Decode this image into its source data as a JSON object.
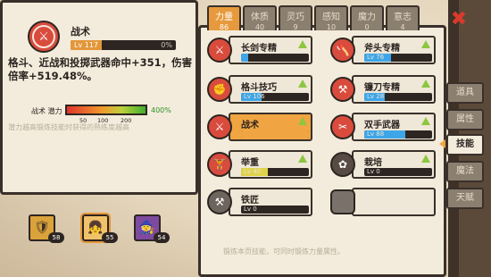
{
  "info": {
    "skill_name": "战术",
    "level": "Lv 117",
    "progress": "0%",
    "description": "格斗、近战和投掷武器命中+351，伤害倍率+519.48%。",
    "potential_label": "战术 潜力",
    "potential_value": "400%",
    "ticks": [
      "50",
      "100",
      "200"
    ],
    "note": "潜力越高锻炼技能时获得的熟练度越高"
  },
  "companions": [
    {
      "level": "58"
    },
    {
      "level": "55"
    },
    {
      "level": "54"
    }
  ],
  "tabs": [
    {
      "label": "力量",
      "value": "86"
    },
    {
      "label": "体质",
      "value": "40"
    },
    {
      "label": "灵巧",
      "value": "9"
    },
    {
      "label": "感知",
      "value": "10"
    },
    {
      "label": "魔力",
      "value": "0"
    },
    {
      "label": "意志",
      "value": "4"
    }
  ],
  "skills": [
    {
      "name": "长剑专精",
      "level": "",
      "icon": "sword-icon",
      "bar_fill": 0.1
    },
    {
      "name": "斧头专精",
      "level": "Lv 76",
      "icon": "axe-icon",
      "bar_fill": 0.4
    },
    {
      "name": "格斗技巧",
      "level": "Lv 106",
      "icon": "fist-icon",
      "bar_fill": 0.3
    },
    {
      "name": "镰刀专精",
      "level": "Lv 28",
      "icon": "scythe-icon",
      "bar_fill": 0.3
    },
    {
      "name": "战术",
      "level": "",
      "icon": "tactics-icon",
      "bar_fill": 1.0
    },
    {
      "name": "双手武器",
      "level": "Lv 88",
      "icon": "twohand-icon",
      "bar_fill": 0.6
    },
    {
      "name": "举重",
      "level": "Lv 40",
      "icon": "dumbbell-icon",
      "bar_fill": 0.4
    },
    {
      "name": "栽培",
      "level": "Lv 0",
      "icon": "plant-icon",
      "bar_fill": 0.0
    },
    {
      "name": "铁匠",
      "level": "Lv 0",
      "icon": "anvil-icon",
      "bar_fill": 0.0
    },
    {
      "name": "",
      "level": "",
      "icon": "locked-hex-icon",
      "bar_fill": 0.0
    }
  ],
  "footer_note": "锻炼本页技能，可同时锻炼力量属性。",
  "side_menu": [
    "道具",
    "属性",
    "技能",
    "魔法",
    "天赋"
  ],
  "colors": {
    "accent": "#e79a3d",
    "danger": "#d93a2c",
    "bar": "#3ea6e8",
    "up": "#8dc63f"
  }
}
